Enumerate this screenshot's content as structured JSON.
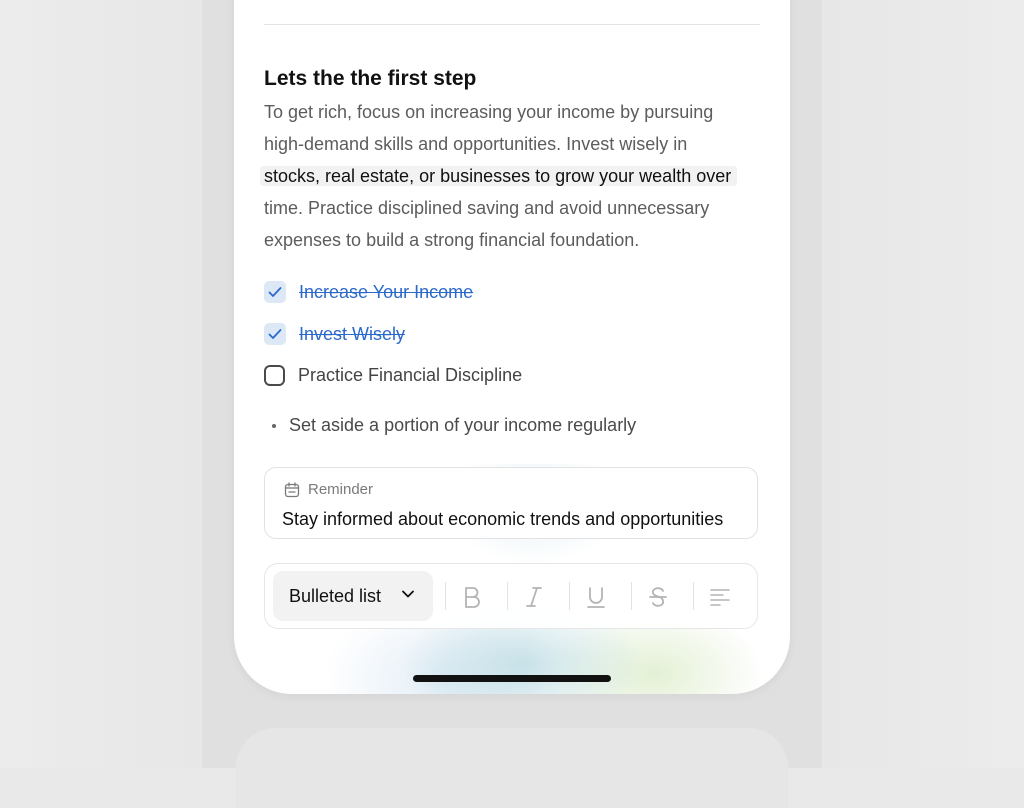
{
  "note": {
    "heading": "Lets the the first step",
    "paragraph": {
      "line1": "To get rich, focus on increasing your income by pursuing",
      "line2": "high-demand skills and opportunities. Invest wisely in",
      "line3_highlighted": "stocks, real estate, or businesses to grow your wealth over",
      "line4": "time. Practice disciplined saving and avoid unnecessary",
      "line5": "expenses to build a strong financial foundation."
    },
    "checklist": [
      {
        "label": "Increase Your Income",
        "checked": true
      },
      {
        "label": "Invest Wisely",
        "checked": true
      },
      {
        "label": "Practice Financial Discipline",
        "checked": false
      }
    ],
    "bullet": "Set aside a portion of your income regularly",
    "reminder": {
      "label": "Reminder",
      "icon": "calendar-icon",
      "text": "Stay informed about economic trends and opportunities"
    }
  },
  "toolbar": {
    "format_select": "Bulleted list",
    "buttons": [
      "bold-icon",
      "italic-icon",
      "underline-icon",
      "strikethrough-icon",
      "align-left-icon"
    ]
  },
  "colors": {
    "checked_text": "#2c6ac9",
    "checkbox_fill": "#dde8f7",
    "highlight_bg": "#f2f2f2"
  }
}
